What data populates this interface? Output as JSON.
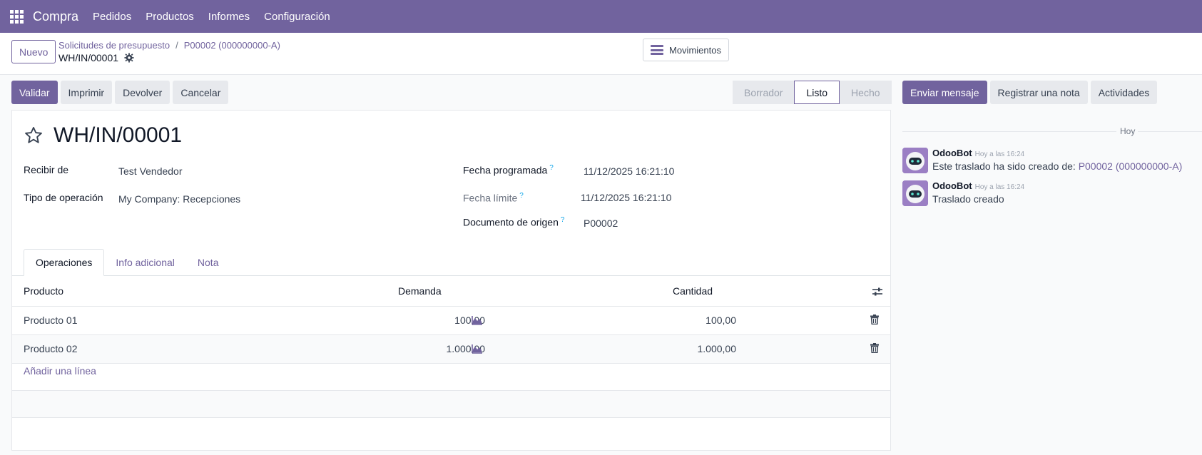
{
  "navbar": {
    "brand": "Compra",
    "menu": [
      "Pedidos",
      "Productos",
      "Informes",
      "Configuración"
    ],
    "bg_color": "#71639e"
  },
  "control": {
    "new_label": "Nuevo",
    "breadcrumb": [
      "Solicitudes de presupuesto",
      "P00002 (000000000-A)"
    ],
    "current": "WH/IN/00001",
    "moves_label": "Movimientos"
  },
  "actions": {
    "validate": "Validar",
    "print": "Imprimir",
    "return": "Devolver",
    "cancel": "Cancelar"
  },
  "status": {
    "stages": [
      "Borrador",
      "Listo",
      "Hecho"
    ],
    "active": "Listo"
  },
  "chatter_actions": {
    "send": "Enviar mensaje",
    "note": "Registrar una nota",
    "activities": "Actividades"
  },
  "record": {
    "name": "WH/IN/00001",
    "fields": {
      "partner_label": "Recibir de",
      "partner_value": "Test Vendedor",
      "optype_label": "Tipo de operación",
      "optype_value": "My Company: Recepciones",
      "scheduled_label": "Fecha programada",
      "scheduled_value": "11/12/2025 16:21:10",
      "deadline_label": "Fecha límite",
      "deadline_value": "11/12/2025 16:21:10",
      "origin_label": "Documento de origen",
      "origin_value": "P00002",
      "help_mark": "?"
    }
  },
  "tabs": [
    "Operaciones",
    "Info adicional",
    "Nota"
  ],
  "table": {
    "headers": {
      "product": "Producto",
      "demand": "Demanda",
      "quantity": "Cantidad"
    },
    "rows": [
      {
        "product": "Producto 01",
        "demand": "100,00",
        "quantity": "100,00"
      },
      {
        "product": "Producto 02",
        "demand": "1.000,00",
        "quantity": "1.000,00"
      }
    ],
    "add_line": "Añadir una línea"
  },
  "chatter": {
    "today": "Hoy",
    "messages": [
      {
        "author": "OdooBot",
        "time": "Hoy a las 16:24",
        "text": "Este traslado ha sido creado de: ",
        "link": "P00002 (000000000-A)"
      },
      {
        "author": "OdooBot",
        "time": "Hoy a las 16:24",
        "text": "Traslado creado",
        "link": ""
      }
    ]
  }
}
